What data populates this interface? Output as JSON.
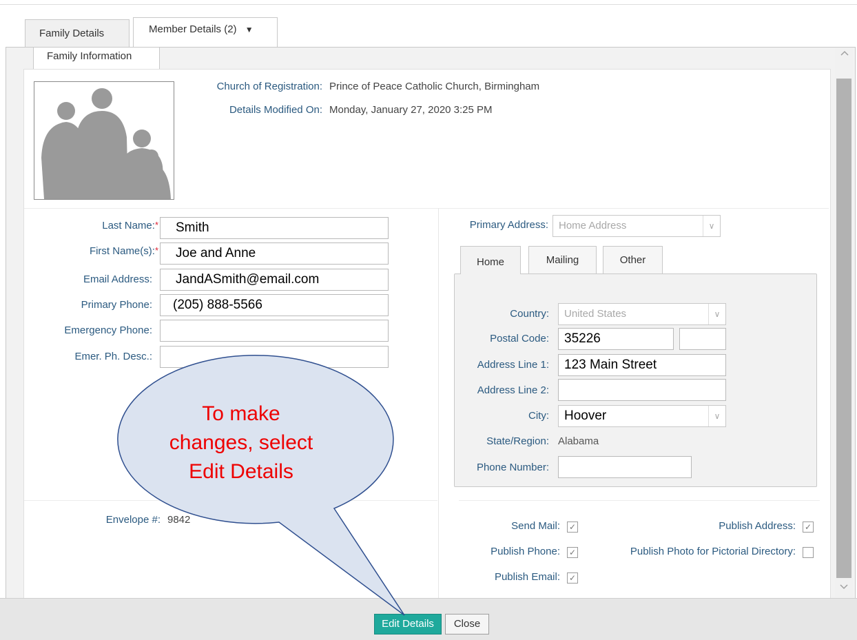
{
  "tabs": [
    {
      "label": "Family Details"
    },
    {
      "label": "Member Details (2)",
      "chevron": "▼"
    }
  ],
  "subtab": {
    "label": "Family Information"
  },
  "info": {
    "church_label": "Church of Registration:",
    "church_value": "Prince of Peace Catholic Church, Birmingham",
    "modified_label": "Details Modified On:",
    "modified_value": "Monday, January 27, 2020 3:25 PM"
  },
  "form": {
    "last_name_label": "Last Name:",
    "last_name_value": "Smith",
    "first_name_label": "First Name(s):",
    "first_name_value": "Joe and Anne",
    "email_label": "Email Address:",
    "email_value": "JandASmith@email.com",
    "phone_label": "Primary Phone:",
    "phone_value": "(205) 888-5566",
    "emergency_label": "Emergency Phone:",
    "emergency_value": "",
    "emer_desc_label": "Emer. Ph. Desc.:",
    "emer_desc_value": "",
    "required_mark": "*"
  },
  "address": {
    "primary_label": "Primary Address:",
    "primary_value": "Home Address",
    "tabs": [
      "Home",
      "Mailing",
      "Other"
    ],
    "country_label": "Country:",
    "country_value": "United States",
    "postal_label": "Postal Code:",
    "postal_value": "35226",
    "postal_ext": "",
    "line1_label": "Address Line 1:",
    "line1_value": "123 Main Street",
    "line2_label": "Address Line 2:",
    "line2_value": "",
    "city_label": "City:",
    "city_value": "Hoover",
    "state_label": "State/Region:",
    "state_value": "Alabama",
    "phone_label": "Phone Number:",
    "phone_value": ""
  },
  "envelope": {
    "label": "Envelope #:",
    "value": "9842"
  },
  "options": {
    "send_mail": {
      "label": "Send Mail:",
      "checked": true
    },
    "publish_address": {
      "label": "Publish Address:",
      "checked": true
    },
    "publish_phone": {
      "label": "Publish Phone:",
      "checked": true
    },
    "publish_photo": {
      "label": "Publish Photo for Pictorial Directory:",
      "checked": false
    },
    "publish_email": {
      "label": "Publish Email:",
      "checked": true
    },
    "check_glyph": "✓"
  },
  "callout": {
    "line1": "To make",
    "line2": "changes, select",
    "line3": "Edit Details"
  },
  "footer": {
    "edit_label": "Edit Details",
    "close_label": "Close"
  },
  "colors": {
    "accent": "#1fa99c",
    "label": "#2b5a80",
    "callout_fill": "#dbe3f0",
    "callout_stroke": "#2f4f8f",
    "callout_text": "#ee0000"
  }
}
